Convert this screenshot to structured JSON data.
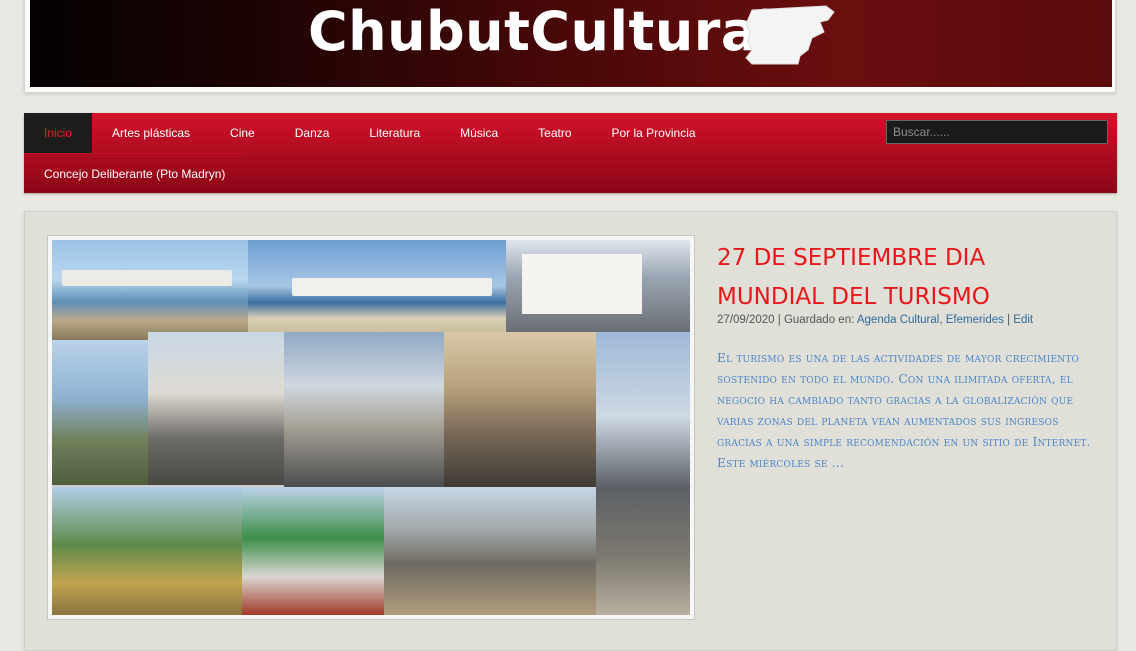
{
  "header": {
    "site_title": "ChubutCultural"
  },
  "nav": {
    "row1": [
      "Inicio",
      "Artes plásticas",
      "Cine",
      "Danza",
      "Literatura",
      "Música",
      "Teatro",
      "Por la Provincia"
    ],
    "row2": [
      "Concejo Deliberante (Pto Madryn)"
    ],
    "active": "Inicio",
    "search_placeholder": "Buscar......"
  },
  "post": {
    "title": "27 DE SEPTIEMBRE DIA MUNDIAL DEL TURISMO",
    "date": "27/09/2020",
    "saved_in_label": "Guardado en:",
    "categories": [
      "Agenda Cultural",
      "Efemerides"
    ],
    "edit_label": "Edit",
    "excerpt": "El turismo es una de las actividades de mayor crecimiento sostenido en todo el mundo. Con una ilimitada oferta, el negocio ha cambiado tanto gracias a la globalización que varias zonas del planeta vean aumentados sus ingresos gracias a una simple recomendación en un sitio de Internet. Este miércoles se ..."
  },
  "colors": {
    "nav_red": "#c4102a",
    "active_bg": "#1e1d1b",
    "title_red": "#e8171a",
    "excerpt_blue": "#4a86c8",
    "link_blue": "#2f6b9d"
  }
}
